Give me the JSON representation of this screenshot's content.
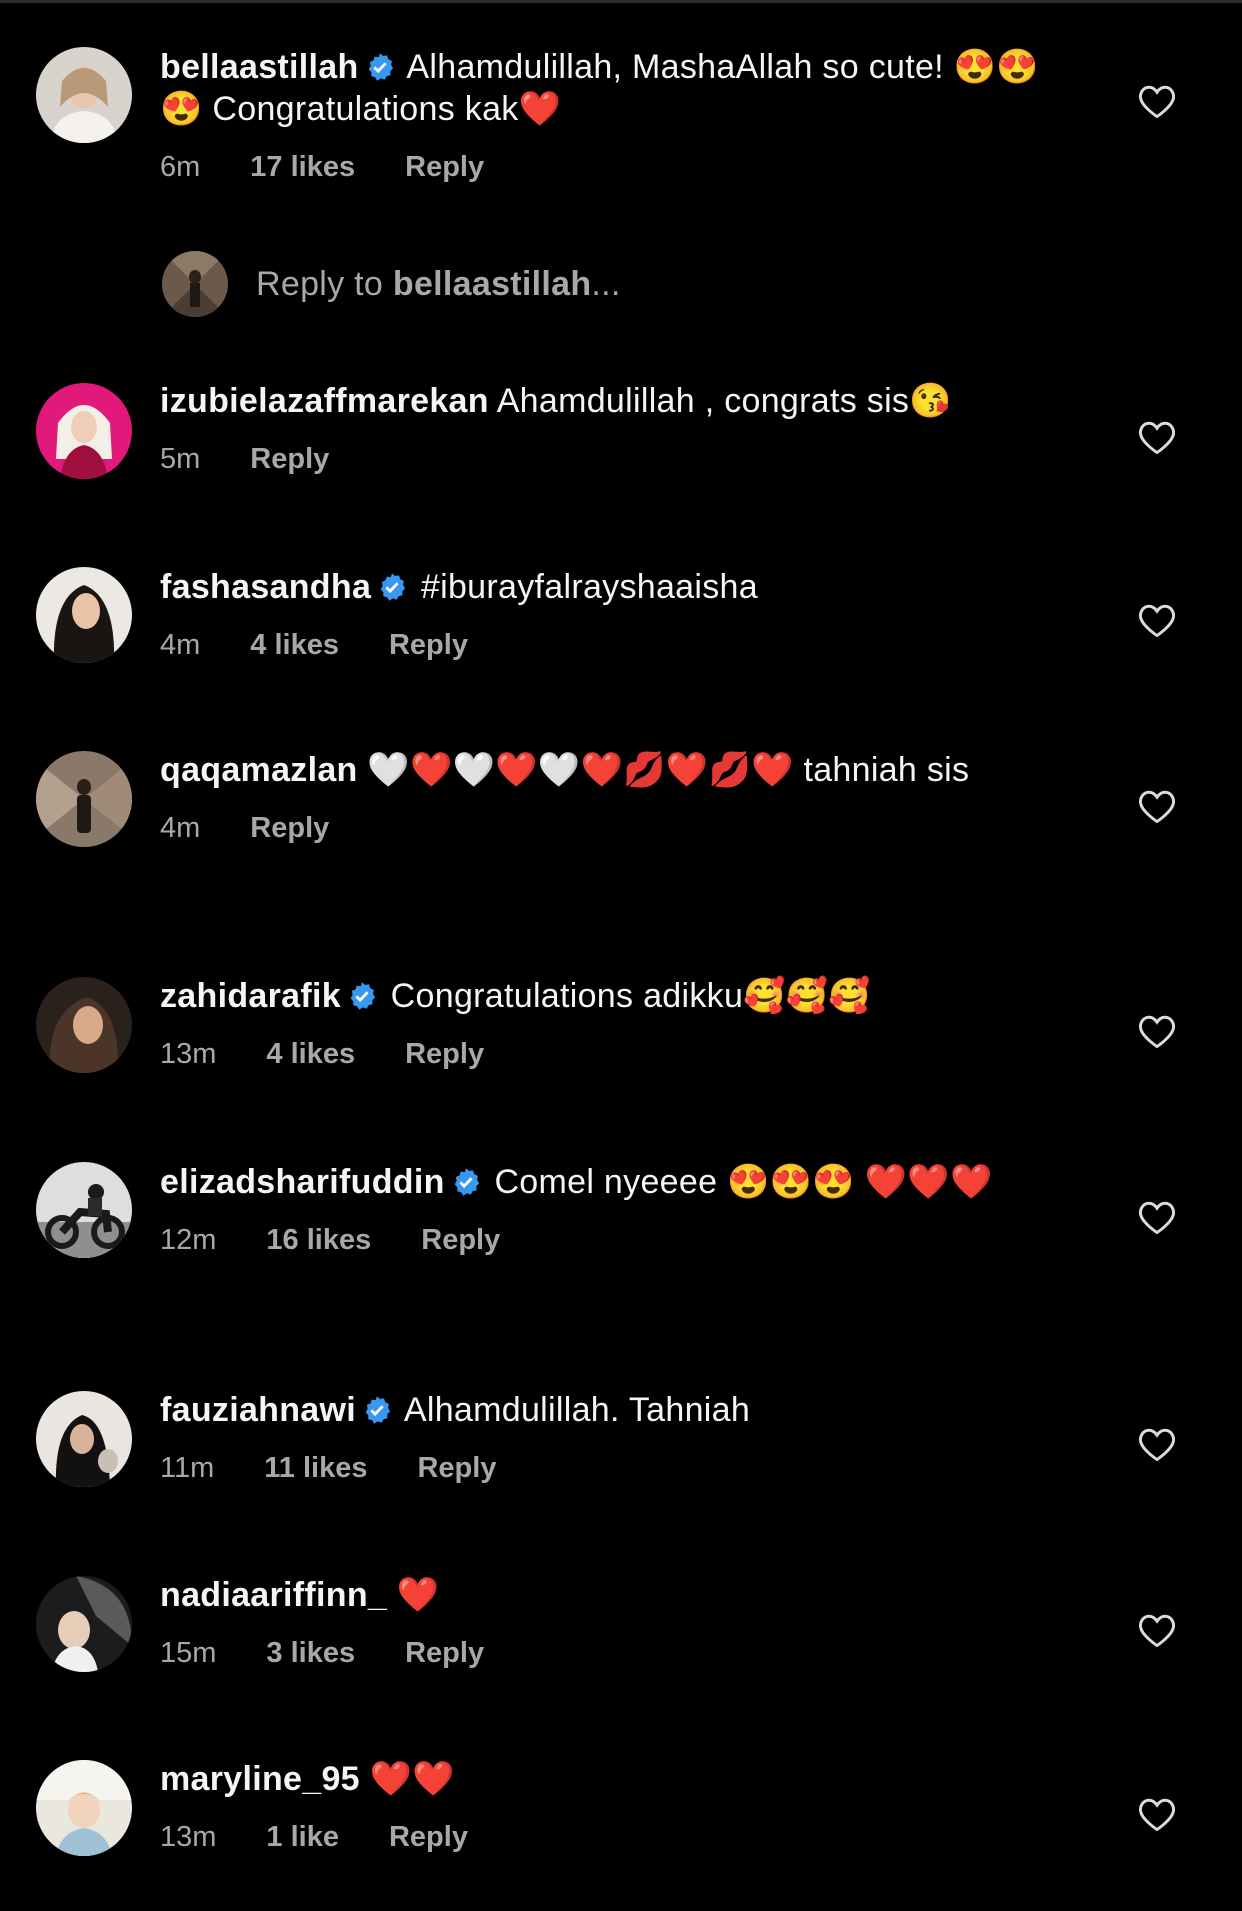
{
  "comments": [
    {
      "username": "bellaastillah",
      "verified": true,
      "text": "Alhamdulillah, MashaAllah so cute! 😍😍😍 Congratulations kak❤️",
      "time": "6m",
      "likes": "17 likes",
      "reply": "Reply"
    },
    {
      "username": "izubielazaffmarekan",
      "verified": false,
      "text": "Ahamdulillah , congrats sis😘",
      "time": "5m",
      "likes": "",
      "reply": "Reply"
    },
    {
      "username": "fashasandha",
      "verified": true,
      "text": "#iburayfalrayshaaisha",
      "time": "4m",
      "likes": "4 likes",
      "reply": "Reply"
    },
    {
      "username": "qaqamazlan",
      "verified": false,
      "text": "🤍❤️🤍❤️🤍❤️💋❤️💋❤️ tahniah sis",
      "time": "4m",
      "likes": "",
      "reply": "Reply"
    },
    {
      "username": "zahidarafik",
      "verified": true,
      "text": "Congratulations adikku🥰🥰🥰",
      "time": "13m",
      "likes": "4 likes",
      "reply": "Reply"
    },
    {
      "username": "elizadsharifuddin",
      "verified": true,
      "text": "Comel nyeeee 😍😍😍 ❤️❤️❤️",
      "time": "12m",
      "likes": "16 likes",
      "reply": "Reply"
    },
    {
      "username": "fauziahnawi",
      "verified": true,
      "text": "Alhamdulillah. Tahniah",
      "time": "11m",
      "likes": "11 likes",
      "reply": "Reply"
    },
    {
      "username": "nadiaariffinn_",
      "verified": false,
      "text": "❤️",
      "time": "15m",
      "likes": "3 likes",
      "reply": "Reply"
    },
    {
      "username": "maryline_95",
      "verified": false,
      "text": "❤️❤️",
      "time": "13m",
      "likes": "1 like",
      "reply": "Reply"
    }
  ],
  "reply_box": {
    "prefix": "Reply to ",
    "target": "bellaastillah",
    "suffix": "..."
  },
  "colors": {
    "background": "#000000",
    "text": "#f5f5f5",
    "meta": "#a8a8a8",
    "verified": "#3897f0",
    "heart_outline": "#dbdbdb"
  },
  "icons": {
    "verified": "verified-badge-icon",
    "like": "heart-outline-icon"
  }
}
